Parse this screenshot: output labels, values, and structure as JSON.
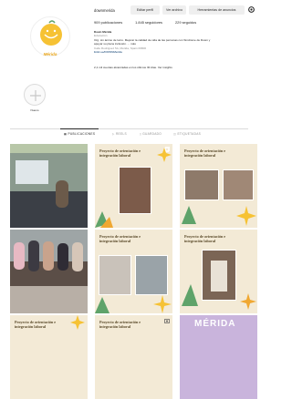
{
  "profile": {
    "logo_text": "Mérida",
    "username": "downmerida",
    "buttons": {
      "edit": "Editar perfil",
      "archive": "Ver archivo",
      "tools": "Herramientas de anuncios"
    },
    "stats": {
      "posts": "909 publicaciones",
      "followers": "1.845 seguidores",
      "following": "229 seguidos"
    },
    "bio": {
      "name": "Down Mérida",
      "category": "Educación",
      "line1": "Org. sin ánimo de lucro. Mejorar la calidad de vida de las personas con Síndrome de Down y",
      "line2": "apoyar su plena inclusión. ... más",
      "address": "Calle Rodríguez 5A, Mérida, Spain 06800",
      "link": "linktr.ee/DOWNMerida"
    },
    "reach_note": "2,1 mil cuentas alcanzadas en los últimos 30 días. Ver insights"
  },
  "highlight": {
    "label": "Nuevo"
  },
  "tabs": [
    {
      "label": "PUBLICACIONES",
      "active": true
    },
    {
      "label": "REELS",
      "active": false
    },
    {
      "label": "GUARDADO",
      "active": false
    },
    {
      "label": "ETIQUETADAS",
      "active": false
    }
  ],
  "posts": [
    {
      "title": ""
    },
    {
      "title": "Proyecto de orientación e integración laboral"
    },
    {
      "title": "Proyecto de orientación e integración laboral"
    },
    {
      "title": ""
    },
    {
      "title": "Proyecto de orientación e integración laboral"
    },
    {
      "title": "Proyecto de orientación e integración laboral"
    },
    {
      "title": "Proyecto de orientación e integración laboral"
    },
    {
      "title": "Proyecto de orientación e integración laboral"
    },
    {
      "title": "MÉRIDA"
    }
  ],
  "colors": {
    "post_bg": "#f3ead6",
    "leaf_green": "#5fa36a",
    "leaf_orange": "#f0a832",
    "purple": "#c9b4dc"
  }
}
